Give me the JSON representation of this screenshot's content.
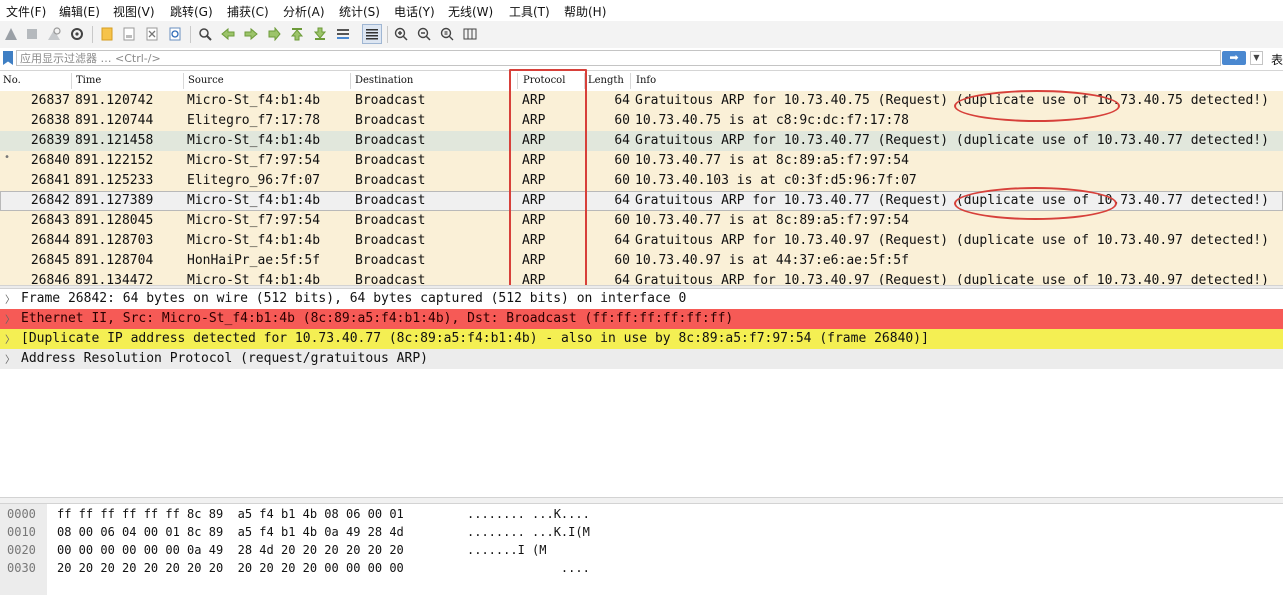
{
  "menu": [
    "文件(F)",
    "编辑(E)",
    "视图(V)",
    "跳转(G)",
    "捕获(C)",
    "分析(A)",
    "统计(S)",
    "电话(Y)",
    "无线(W)",
    "工具(T)",
    "帮助(H)"
  ],
  "toolbar_icons": [
    "start-capture-icon",
    "stop-capture-icon",
    "restart-capture-icon",
    "capture-options-icon",
    "open-file-icon",
    "save-file-icon",
    "close-file-icon",
    "reload-file-icon",
    "find-packet-icon",
    "go-back-icon",
    "go-forward-icon",
    "go-to-packet-icon",
    "go-first-icon",
    "go-last-icon",
    "autoscroll-icon",
    "colorize-icon",
    "zoom-in-icon",
    "zoom-out-icon",
    "normal-size-icon",
    "resize-columns-icon"
  ],
  "filter": {
    "placeholder": "应用显示过滤器 … <Ctrl-/>",
    "apply_icon": "arrow-right-icon",
    "expression_label": "表"
  },
  "packet_list": {
    "columns": [
      "No.",
      "Time",
      "Source",
      "Destination",
      "Protocol",
      "Length",
      "Info"
    ],
    "rows": [
      {
        "no": "26837",
        "time": "891.120742",
        "source": "Micro-St_f4:b1:4b",
        "destination": "Broadcast",
        "protocol": "ARP",
        "length": "64",
        "info": "Gratuitous ARP for 10.73.40.75 (Request) (duplicate use of 10.73.40.75 detected!)",
        "bg": "#faf0d7"
      },
      {
        "no": "26838",
        "time": "891.120744",
        "source": "Elitegro_f7:17:78",
        "destination": "Broadcast",
        "protocol": "ARP",
        "length": "60",
        "info": "10.73.40.75 is at c8:9c:dc:f7:17:78",
        "bg": "#faf0d7"
      },
      {
        "no": "26839",
        "time": "891.121458",
        "source": "Micro-St_f4:b1:4b",
        "destination": "Broadcast",
        "protocol": "ARP",
        "length": "64",
        "info": "Gratuitous ARP for 10.73.40.77 (Request) (duplicate use of 10.73.40.77 detected!)",
        "bg": "#e1e7dc"
      },
      {
        "no": "26840",
        "time": "891.122152",
        "source": "Micro-St_f7:97:54",
        "destination": "Broadcast",
        "protocol": "ARP",
        "length": "60",
        "info": "10.73.40.77 is at 8c:89:a5:f7:97:54",
        "bg": "#faf0d7",
        "marker": "•"
      },
      {
        "no": "26841",
        "time": "891.125233",
        "source": "Elitegro_96:7f:07",
        "destination": "Broadcast",
        "protocol": "ARP",
        "length": "60",
        "info": "10.73.40.103 is at c0:3f:d5:96:7f:07",
        "bg": "#faf0d7"
      },
      {
        "no": "26842",
        "time": "891.127389",
        "source": "Micro-St_f4:b1:4b",
        "destination": "Broadcast",
        "protocol": "ARP",
        "length": "64",
        "info": "Gratuitous ARP for 10.73.40.77 (Request) (duplicate use of 10.73.40.77 detected!)",
        "bg": "#f0f0f0",
        "selected": true
      },
      {
        "no": "26843",
        "time": "891.128045",
        "source": "Micro-St_f7:97:54",
        "destination": "Broadcast",
        "protocol": "ARP",
        "length": "60",
        "info": "10.73.40.77 is at 8c:89:a5:f7:97:54",
        "bg": "#faf0d7"
      },
      {
        "no": "26844",
        "time": "891.128703",
        "source": "Micro-St_f4:b1:4b",
        "destination": "Broadcast",
        "protocol": "ARP",
        "length": "64",
        "info": "Gratuitous ARP for 10.73.40.97 (Request) (duplicate use of 10.73.40.97 detected!)",
        "bg": "#faf0d7"
      },
      {
        "no": "26845",
        "time": "891.128704",
        "source": "HonHaiPr_ae:5f:5f",
        "destination": "Broadcast",
        "protocol": "ARP",
        "length": "60",
        "info": "10.73.40.97 is at 44:37:e6:ae:5f:5f",
        "bg": "#faf0d7"
      },
      {
        "no": "26846",
        "time": "891.134472",
        "source": "Micro-St_f4:b1:4b",
        "destination": "Broadcast",
        "protocol": "ARP",
        "length": "64",
        "info": "Gratuitous ARP for 10.73.40.97 (Request) (duplicate use of 10.73.40.97 detected!)",
        "bg": "#faf0d7"
      }
    ]
  },
  "details": [
    {
      "text": "Frame 26842: 64 bytes on wire (512 bits), 64 bytes captured (512 bits) on interface 0",
      "bg": "#ffffff",
      "color": "#111111"
    },
    {
      "text": "Ethernet II, Src: Micro-St_f4:b1:4b (8c:89:a5:f4:b1:4b), Dst: Broadcast (ff:ff:ff:ff:ff:ff)",
      "bg": "#f65a56",
      "color": "#2b0000"
    },
    {
      "text": "[Duplicate IP address detected for 10.73.40.77 (8c:89:a5:f4:b1:4b) - also in use by 8c:89:a5:f7:97:54 (frame 26840)]",
      "bg": "#f4ef53",
      "color": "#111111"
    },
    {
      "text": "Address Resolution Protocol (request/gratuitous ARP)",
      "bg": "#ececec",
      "color": "#111111"
    }
  ],
  "bytes": [
    {
      "offset": "0000",
      "hex": "ff ff ff ff ff ff 8c 89  a5 f4 b1 4b 08 06 00 01",
      "ascii": "........ ...K...."
    },
    {
      "offset": "0010",
      "hex": "08 00 06 04 00 01 8c 89  a5 f4 b1 4b 0a 49 28 4d",
      "ascii": "........ ...K.I(M"
    },
    {
      "offset": "0020",
      "hex": "00 00 00 00 00 00 0a 49  28 4d 20 20 20 20 20 20",
      "ascii": ".......I (M"
    },
    {
      "offset": "0030",
      "hex": "20 20 20 20 20 20 20 20  20 20 20 20 00 00 00 00",
      "ascii": "             ...."
    }
  ],
  "highlight_color": "#d7403a"
}
